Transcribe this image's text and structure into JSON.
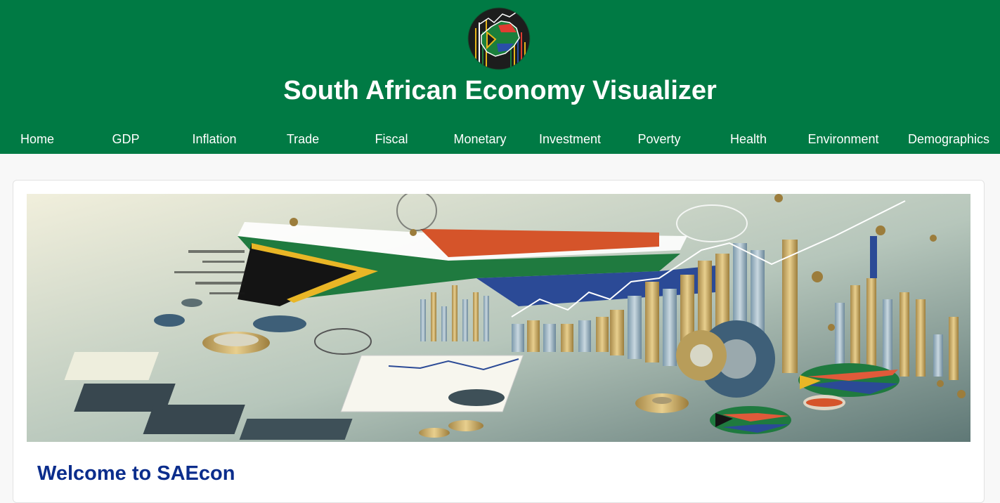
{
  "header": {
    "logo_icon": "south-africa-map-chart-logo",
    "title": "South African Economy Visualizer",
    "bg_color": "#007a44"
  },
  "nav": {
    "items": [
      {
        "label": "Home"
      },
      {
        "label": "GDP"
      },
      {
        "label": "Inflation"
      },
      {
        "label": "Trade"
      },
      {
        "label": "Fiscal"
      },
      {
        "label": "Monetary"
      },
      {
        "label": "Investment"
      },
      {
        "label": "Poverty"
      },
      {
        "label": "Health"
      },
      {
        "label": "Environment"
      },
      {
        "label": "Demographics"
      }
    ]
  },
  "main": {
    "banner_icon": "south-africa-flag-economy-banner-image",
    "welcome_heading": "Welcome to SAEcon",
    "heading_color": "#0b2d8c"
  }
}
